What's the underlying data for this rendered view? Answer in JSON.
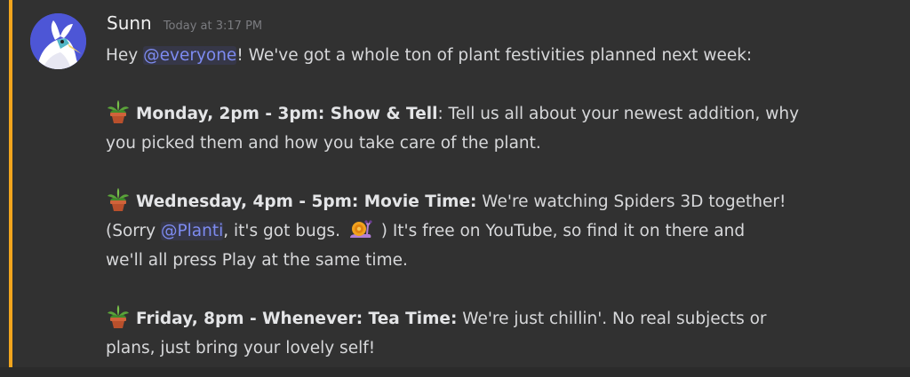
{
  "message": {
    "author": "Sunn",
    "timestamp": "Today at 3:17 PM",
    "intro": {
      "pre": "Hey ",
      "mention": "@everyone",
      "post": "! We've got a whole ton of plant festivities planned next week:"
    },
    "events": [
      {
        "emoji": "potted-plant-icon",
        "title": "Monday, 2pm - 3pm: Show & Tell",
        "after_title": ": Tell us all about your newest addition, why",
        "line2": "you picked them and how you take care of the plant."
      },
      {
        "emoji": "potted-plant-icon",
        "title": "Wednesday, 4pm - 5pm: Movie Time:",
        "after_title": " We're watching Spiders 3D together!",
        "line2_pre": "(Sorry ",
        "line2_mention": "@Planti",
        "line2_mid": ", it's got bugs. ",
        "line2_emoji": "snail-icon",
        "line2_post": " ) It's free on YouTube, so find it on there and",
        "line3": "we'll all press Play at the same time."
      },
      {
        "emoji": "potted-plant-icon",
        "title": "Friday, 8pm - Whenever: Tea Time:",
        "after_title": " We're just chillin'. No real subjects or",
        "line2": "plans, just bring your lovely self!"
      }
    ]
  },
  "colors": {
    "background": "#313131",
    "mention_bar": "#f2a51d",
    "mention_text": "#7d8bf0",
    "avatar_bg": "#4d56d6"
  }
}
